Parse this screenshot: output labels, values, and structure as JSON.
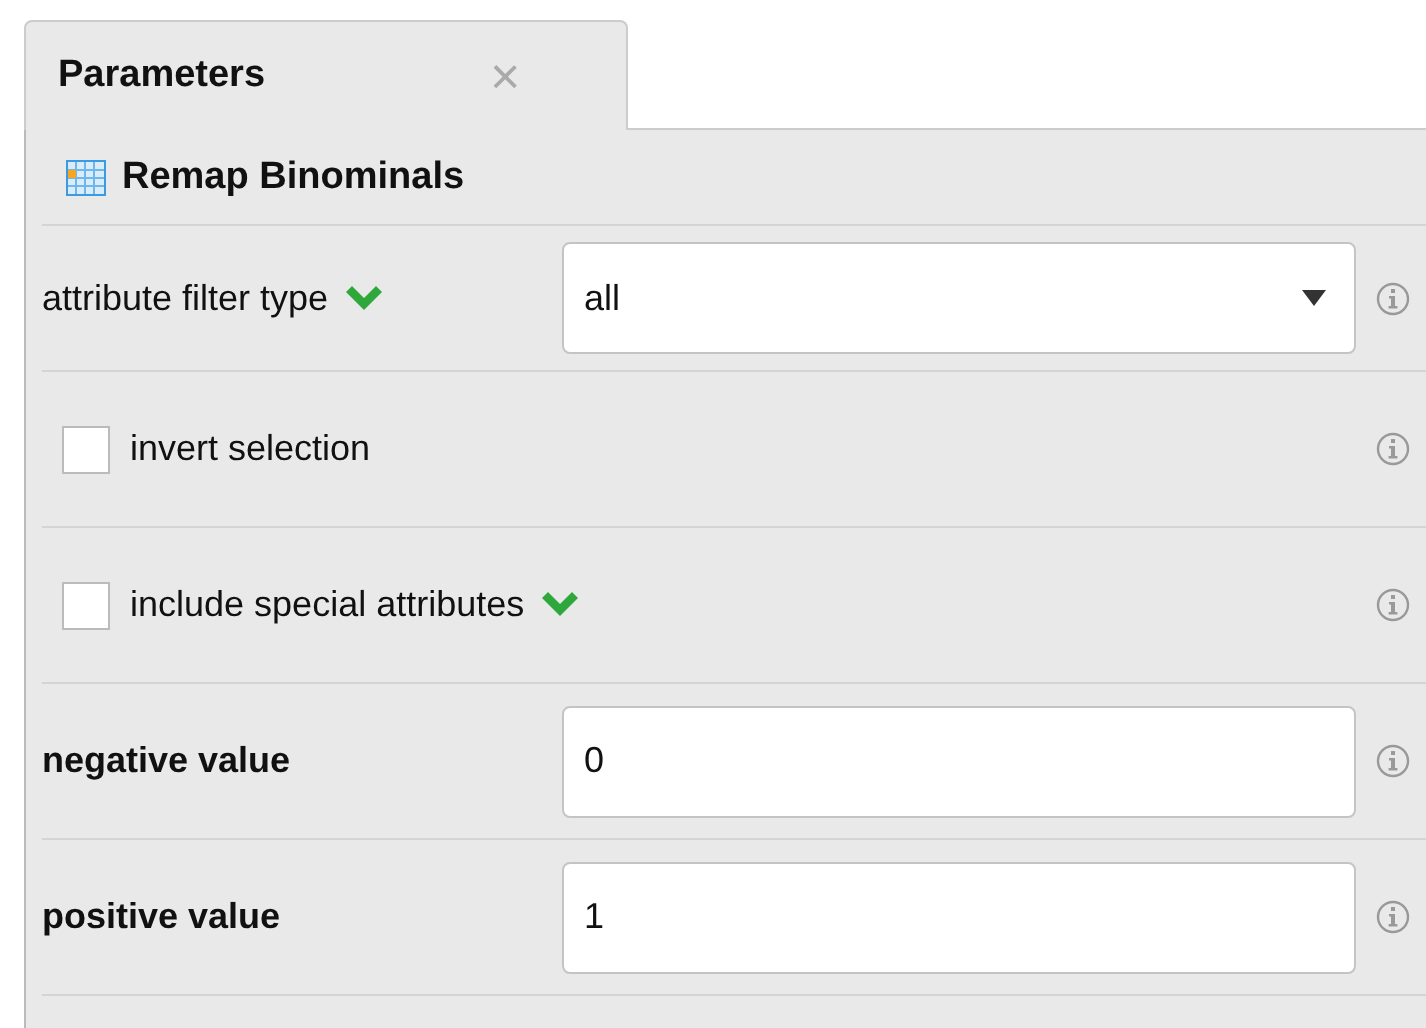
{
  "tab": {
    "label": "Parameters",
    "close": "×"
  },
  "operator": {
    "name": "Remap Binominals"
  },
  "parameters": [
    {
      "kind": "select",
      "label": "attribute filter type",
      "required": false,
      "expert": true,
      "value": "all"
    },
    {
      "kind": "checkbox",
      "label": "invert selection",
      "required": false,
      "expert": false,
      "checked": false
    },
    {
      "kind": "checkbox",
      "label": "include special attributes",
      "required": false,
      "expert": true,
      "checked": false
    },
    {
      "kind": "text",
      "label": "negative value",
      "required": true,
      "expert": false,
      "value": "0"
    },
    {
      "kind": "text",
      "label": "positive value",
      "required": true,
      "expert": false,
      "value": "1"
    }
  ]
}
